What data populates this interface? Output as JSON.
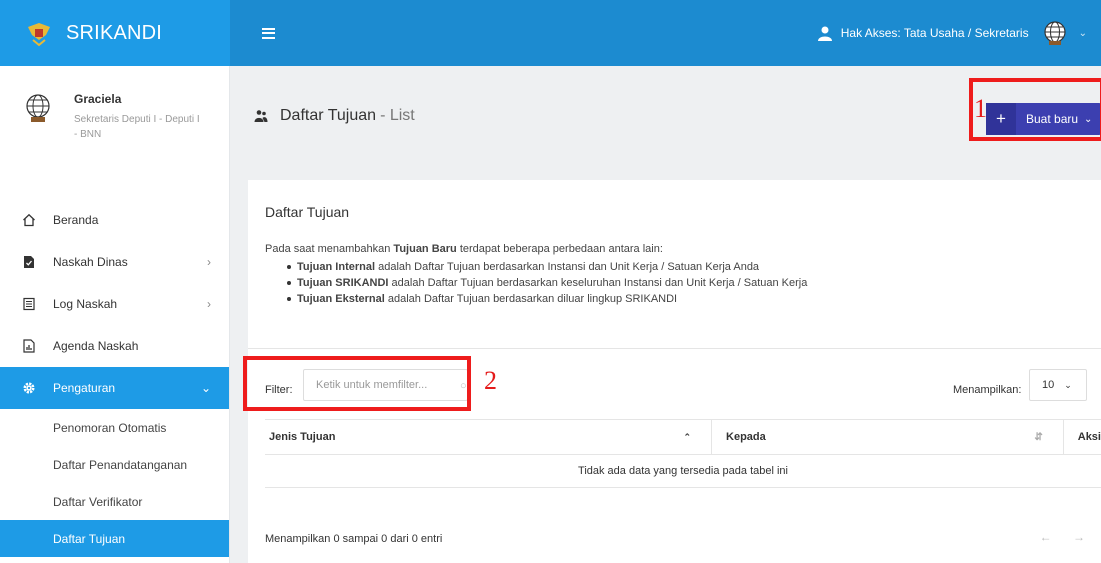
{
  "app": {
    "name": "SRIKANDI"
  },
  "topbar": {
    "access_label": "Hak Akses: Tata Usaha / Sekretaris"
  },
  "profile": {
    "name": "Graciela",
    "role": "Sekretaris Deputi I - Deputi I - BNN"
  },
  "nav": {
    "beranda": "Beranda",
    "naskah_dinas": "Naskah Dinas",
    "log_naskah": "Log Naskah",
    "agenda_naskah": "Agenda Naskah",
    "pengaturan": "Pengaturan",
    "sub": {
      "penomoran": "Penomoran Otomatis",
      "penandatangan": "Daftar Penandatanganan",
      "verifikator": "Daftar Verifikator",
      "tujuan": "Daftar Tujuan"
    }
  },
  "page": {
    "title": "Daftar Tujuan",
    "subtitle": "- List",
    "new_button": "Buat baru"
  },
  "annotations": {
    "one": "1",
    "two": "2"
  },
  "card": {
    "title": "Daftar Tujuan",
    "intro_pre": "Pada saat menambahkan ",
    "intro_bold": "Tujuan Baru",
    "intro_post": " terdapat beberapa perbedaan antara lain:",
    "items": [
      {
        "bold": "Tujuan Internal",
        "text": " adalah Daftar Tujuan berdasarkan Instansi dan Unit Kerja / Satuan Kerja Anda"
      },
      {
        "bold": "Tujuan SRIKANDI",
        "text": " adalah Daftar Tujuan berdasarkan keseluruhan Instansi dan Unit Kerja / Satuan Kerja"
      },
      {
        "bold": "Tujuan Eksternal",
        "text": " adalah Daftar Tujuan berdasarkan diluar lingkup SRIKANDI"
      }
    ]
  },
  "filter": {
    "label": "Filter:",
    "placeholder": "Ketik untuk memfilter..."
  },
  "page_size": {
    "label": "Menampilkan:",
    "value": "10"
  },
  "table": {
    "columns": [
      "Jenis Tujuan",
      "Kepada",
      "Aksi"
    ],
    "empty_text": "Tidak ada data yang tersedia pada tabel ini",
    "info": "Menampilkan 0 sampai 0 dari 0 entri"
  },
  "colors": {
    "primary": "#1e9be6",
    "topbar": "#1c8bd0",
    "button": "#3c3fb0",
    "highlight": "#ee1c1c"
  }
}
